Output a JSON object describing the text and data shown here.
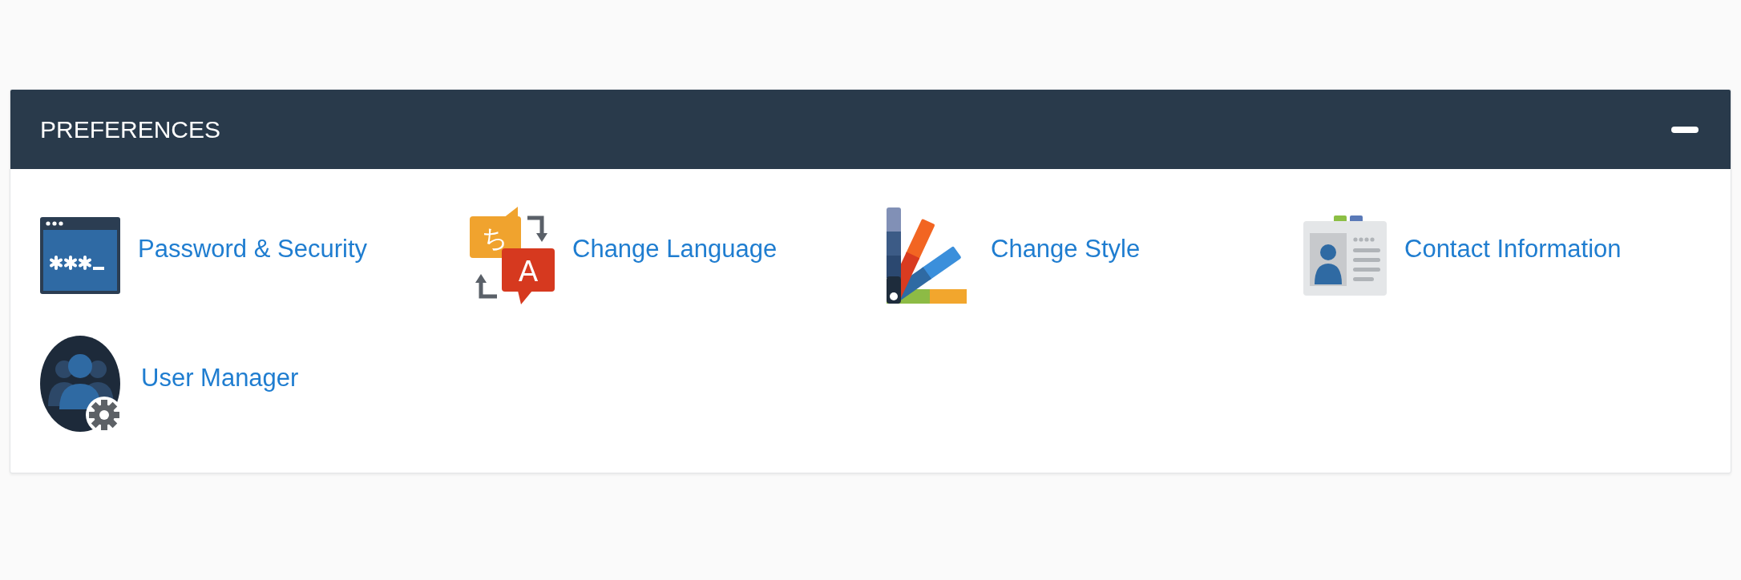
{
  "panel": {
    "title": "PREFERENCES",
    "expanded": true,
    "items": [
      {
        "kind": "password",
        "label": "Password & Security"
      },
      {
        "kind": "language",
        "label": "Change Language",
        "glyphs": [
          "ち",
          "A"
        ]
      },
      {
        "kind": "style",
        "label": "Change Style"
      },
      {
        "kind": "contact",
        "label": "Contact Information"
      },
      {
        "kind": "users",
        "label": "User Manager"
      }
    ]
  }
}
